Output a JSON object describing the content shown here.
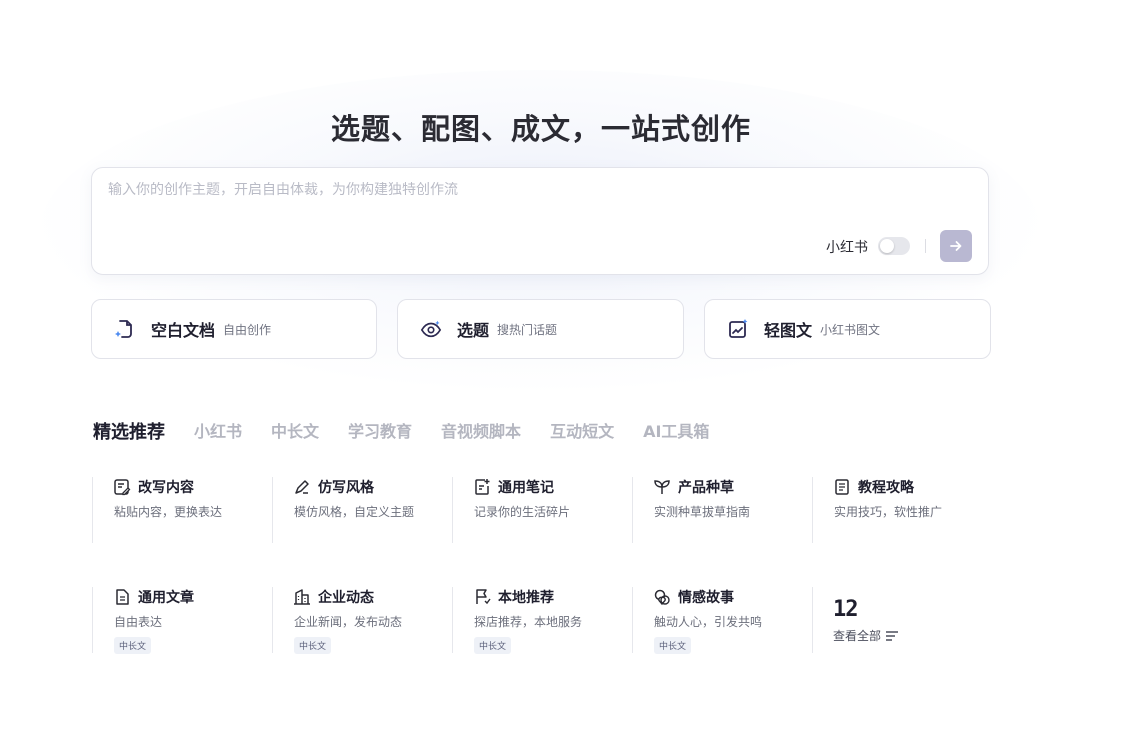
{
  "headline": "选题、配图、成文，一站式创作",
  "prompt": {
    "placeholder": "输入你的创作主题，开启自由体裁，为你构建独特创作流",
    "platform_label": "小红书",
    "platform_toggle_on": false
  },
  "modes": [
    {
      "title": "空白文档",
      "sub": "自由创作",
      "icon": "doc-icon"
    },
    {
      "title": "选题",
      "sub": "搜热门话题",
      "icon": "eye-icon"
    },
    {
      "title": "轻图文",
      "sub": "小红书图文",
      "icon": "image-text-icon"
    }
  ],
  "tabs": [
    "精选推荐",
    "小红书",
    "中长文",
    "学习教育",
    "音视频脚本",
    "互动短文",
    "AI工具箱"
  ],
  "active_tab": "精选推荐",
  "templates": [
    {
      "name": "改写内容",
      "desc": "粘贴内容，更换表达",
      "icon": "edit-icon"
    },
    {
      "name": "仿写风格",
      "desc": "模仿风格，自定义主题",
      "icon": "pen-icon"
    },
    {
      "name": "通用笔记",
      "desc": "记录你的生活碎片",
      "icon": "note-icon"
    },
    {
      "name": "产品种草",
      "desc": "实测种草拔草指南",
      "icon": "sprout-icon"
    },
    {
      "name": "教程攻略",
      "desc": "实用技巧，软性推广",
      "icon": "book-icon"
    },
    {
      "name": "通用文章",
      "desc": "自由表达",
      "badge": "中长文",
      "icon": "article-icon"
    },
    {
      "name": "企业动态",
      "desc": "企业新闻，发布动态",
      "badge": "中长文",
      "icon": "building-icon"
    },
    {
      "name": "本地推荐",
      "desc": "探店推荐，本地服务",
      "badge": "中长文",
      "icon": "flag-icon"
    },
    {
      "name": "情感故事",
      "desc": "触动人心，引发共鸣",
      "badge": "中长文",
      "icon": "heart-icon"
    }
  ],
  "more": {
    "count": "12",
    "label": "查看全部"
  },
  "colors": {
    "accent": "#5b4de0",
    "send_button": "#b9b8d2",
    "text": "#1f1f2e",
    "muted": "#b4b6c0"
  }
}
